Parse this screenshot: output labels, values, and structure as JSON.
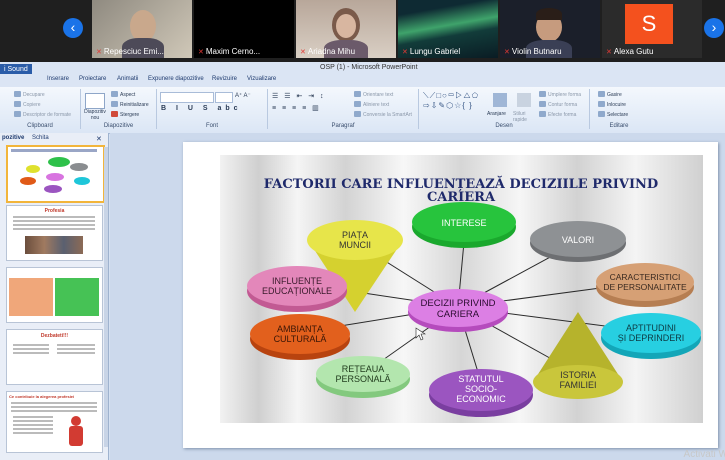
{
  "meeting": {
    "participants": [
      {
        "name": "Repesciuc Emi..."
      },
      {
        "name": "Maxim Cerno..."
      },
      {
        "name": "Ariadna Mihu"
      },
      {
        "name": "Lungu Gabriel"
      },
      {
        "name": "Violin Butnaru"
      },
      {
        "name": "Alexa Gutu",
        "initial": "S"
      }
    ],
    "prev_icon": "chevron-left-icon",
    "next_icon": "chevron-right-icon"
  },
  "ppt": {
    "title": "OSP (1) - Microsoft PowerPoint",
    "app_button": "i Sound",
    "tabs": [
      "Inserare",
      "Proiectare",
      "Animatii",
      "Expunere diapozitive",
      "Revizuire",
      "Vizualizare"
    ],
    "ribbon": {
      "clipboard": {
        "label": "Clipboard",
        "cut": "Decupare",
        "copy": "Copiere",
        "format_painter": "Descriptor de formate"
      },
      "slides": {
        "label": "Diapozitive",
        "new_slide": "Diapozitiv nou",
        "layout": "Aspect",
        "reset": "Reinitializare",
        "delete": "Stergere"
      },
      "font": {
        "label": "Font"
      },
      "paragraph": {
        "label": "Paragraf",
        "text_direction": "Orientare text",
        "align_text": "Aliniere text",
        "smartart": "Conversie la SmartArt"
      },
      "drawing": {
        "label": "Desen",
        "arrange": "Aranjare",
        "quick_styles": "Stiluri rapide",
        "fill": "Umplere forma",
        "outline": "Contur forma",
        "effects": "Efecte forma"
      },
      "editing": {
        "label": "Editare",
        "find": "Gasire",
        "replace": "Inlocuire",
        "select": "Selectare"
      }
    },
    "left_pane": {
      "tab_slides": "pozitive",
      "tab_outline": "Schita"
    },
    "thumbnails": [
      {
        "title": ""
      },
      {
        "title": "Profesia"
      },
      {
        "title": ""
      },
      {
        "title": "Dezbateti!!!"
      },
      {
        "title": "Ce contribuie la alegerea profesiei"
      }
    ],
    "watermark": "Activati W"
  },
  "slide": {
    "title": "FACTORII CARE INFLUENȚEAZĂ DECIZIILE PRIVIND CARIERA",
    "center": "DECIZII PRIVIND CARIERA",
    "factors": [
      "PIAȚA MUNCII",
      "INTERESE",
      "VALORI",
      "CARACTERISTICI DE PERSONALITATE",
      "APTITUDINI ȘI DEPRINDERI",
      "ISTORIA FAMILIEI",
      "STATUTUL SOCIO-ECONOMIC",
      "REȚEAUA PERSONALĂ",
      "AMBIANȚA CULTURALĂ",
      "INFLUENȚE EDUCAȚIONALE"
    ],
    "colors": {
      "title": "#1f2a6b",
      "center": "#d874e0",
      "green": "#22c13a",
      "gray": "#8a8d90",
      "peach": "#d29a6a",
      "cyan": "#1ec6d9",
      "olive": "#c2c13a",
      "purple": "#9b55c0",
      "mint": "#a8e0a2",
      "orange": "#e05a18",
      "pink": "#e07ab0",
      "yellow": "#dfe12e"
    }
  }
}
